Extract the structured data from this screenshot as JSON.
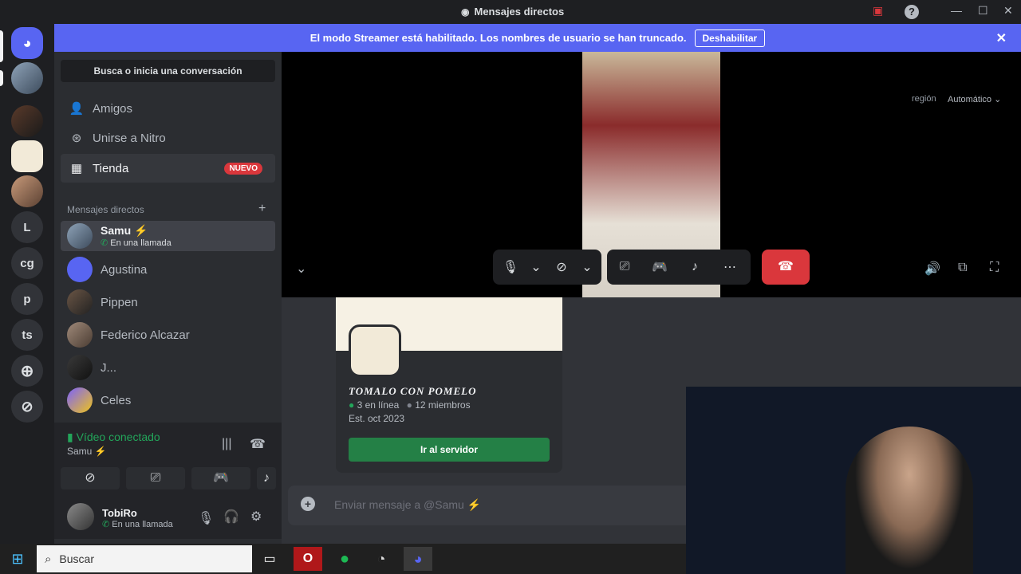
{
  "window": {
    "title": "Mensajes directos"
  },
  "banner": {
    "text": "El modo Streamer está habilitado. Los nombres de usuario se han truncado.",
    "button": "Deshabilitar"
  },
  "servers": [
    "L",
    "cg",
    "p",
    "ts"
  ],
  "search": {
    "placeholder": "Busca o inicia una conversación"
  },
  "nav": {
    "friends": "Amigos",
    "nitro": "Unirse a Nitro",
    "shop": "Tienda",
    "shop_badge": "NUEVO"
  },
  "dm_header": "Mensajes directos",
  "dms": [
    {
      "name": "Samu ⚡",
      "status": "En una llamada"
    },
    {
      "name": "Agustina"
    },
    {
      "name": "Pippen"
    },
    {
      "name": "Federico Alcazar"
    },
    {
      "name": "J..."
    },
    {
      "name": "Celes"
    }
  ],
  "voice": {
    "status": "Vídeo conectado",
    "channel": "Samu ⚡"
  },
  "user": {
    "name": "TobiRo",
    "status": "En una llamada"
  },
  "video": {
    "region_label": "región",
    "region_value": "Automático"
  },
  "invite": {
    "server_name": "TOMALO CON POMELO",
    "online": "3 en línea",
    "members": "12 miembros",
    "established": "Est. oct 2023",
    "button": "Ir al servidor"
  },
  "composer": {
    "placeholder": "Enviar mensaje a @Samu ⚡"
  },
  "taskbar": {
    "search": "Buscar"
  },
  "colors": {
    "brand": "#5865f2",
    "green": "#23a55a",
    "red": "#da373c"
  }
}
